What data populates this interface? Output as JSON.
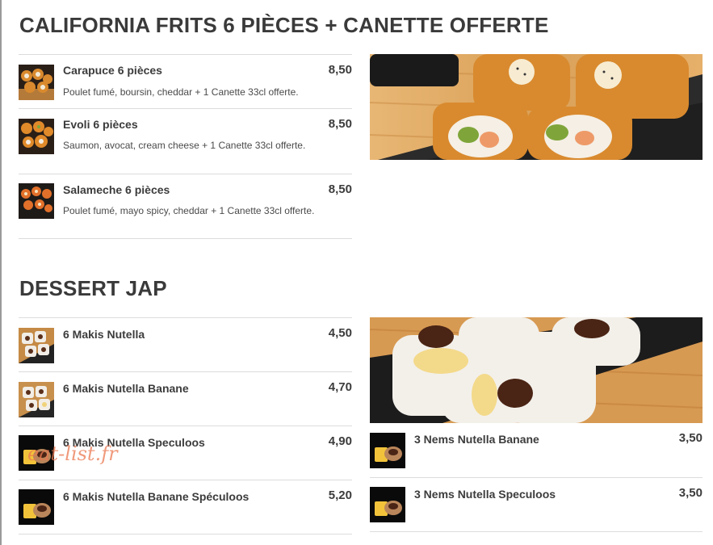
{
  "sections": [
    {
      "title": "CALIFORNIA FRITS 6 PIÈCES + CANETTE OFFERTE",
      "items": [
        {
          "name": "Carapuce 6 pièces",
          "desc": "Poulet fumé, boursin, cheddar + 1 Canette 33cl offerte.",
          "price": "8,50"
        },
        {
          "name": "Evoli 6 pièces",
          "desc": "Saumon, avocat, cream cheese + 1 Canette 33cl offerte.",
          "price": "8,50"
        },
        {
          "name": "Salameche 6 pièces",
          "desc": "Poulet fumé, mayo spicy, cheddar + 1 Canette 33cl offerte.",
          "price": "8,50"
        }
      ]
    },
    {
      "title": "DESSERT JAP",
      "items": [
        {
          "name": "6 Makis Nutella",
          "price": "4,50"
        },
        {
          "name": "6 Makis Nutella Banane",
          "price": "4,70"
        },
        {
          "name": "6 Makis Nutella Speculoos",
          "price": "4,90"
        },
        {
          "name": "6 Makis Nutella Banane Spéculoos",
          "price": "5,20"
        },
        {
          "name": "3 Nems Nutella Banane",
          "price": "3,50"
        },
        {
          "name": "3 Nems Nutella Speculoos",
          "price": "3,50"
        }
      ]
    }
  ],
  "watermark": "eat-list.fr"
}
